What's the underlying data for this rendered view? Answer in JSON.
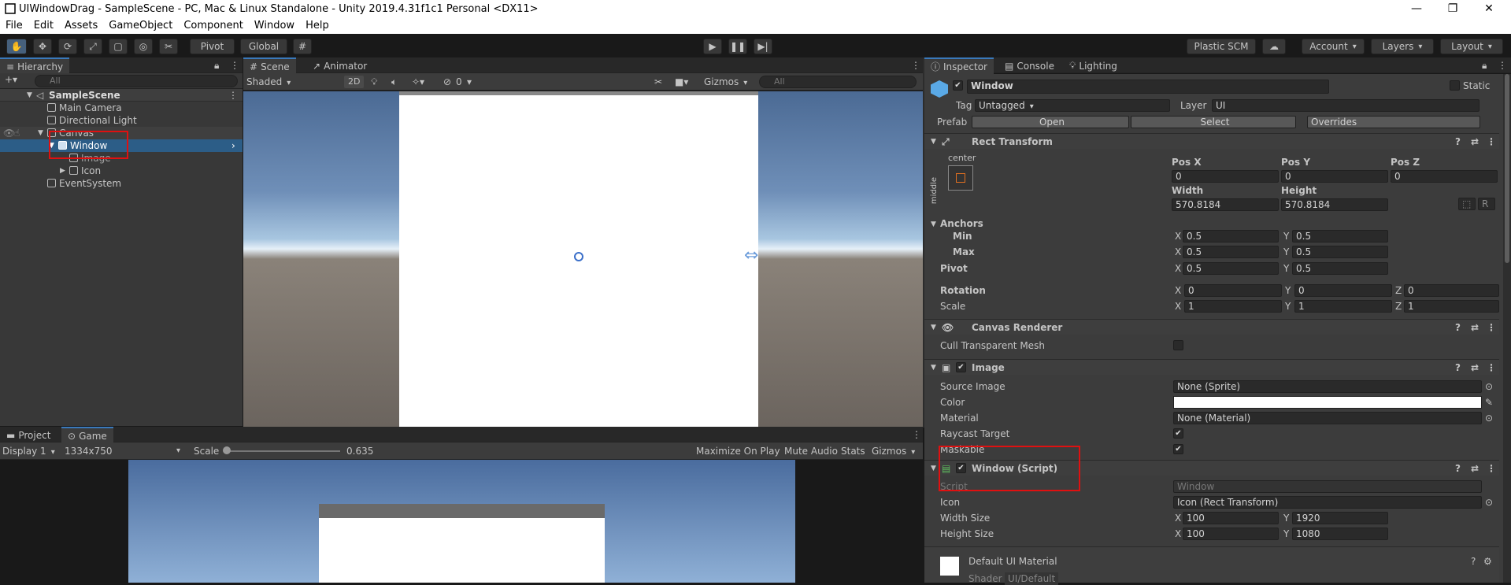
{
  "window": {
    "title": "UIWindowDrag - SampleScene - PC, Mac & Linux Standalone - Unity 2019.4.31f1c1 Personal <DX11>",
    "min": "—",
    "max": "❐",
    "close": "✕"
  },
  "menu": [
    "File",
    "Edit",
    "Assets",
    "GameObject",
    "Component",
    "Window",
    "Help"
  ],
  "toolbar": {
    "pivot": "Pivot",
    "global": "Global",
    "plastic": "Plastic SCM",
    "account": "Account",
    "layers": "Layers",
    "layout": "Layout"
  },
  "hierarchy": {
    "tab": "Hierarchy",
    "search_placeholder": "All",
    "scene": "SampleScene",
    "items": [
      "Main Camera",
      "Directional Light",
      "Canvas",
      "Window",
      "Image",
      "Icon",
      "EventSystem"
    ]
  },
  "scene_view": {
    "tab_scene": "Scene",
    "tab_animator": "Animator",
    "shading": "Shaded",
    "mode_2d": "2D",
    "fx_count": "0",
    "gizmos": "Gizmos",
    "search_placeholder": "All"
  },
  "game_view": {
    "tab_project": "Project",
    "tab_game": "Game",
    "display": "Display 1",
    "resolution": "1334x750",
    "scale_label": "Scale",
    "scale_value": "0.635",
    "maximize": "Maximize On Play",
    "mute": "Mute Audio",
    "stats": "Stats",
    "gizmos": "Gizmos"
  },
  "inspector": {
    "tabs": [
      "Inspector",
      "Console",
      "Lighting"
    ],
    "object_name": "Window",
    "static": "Static",
    "tag_label": "Tag",
    "tag": "Untagged",
    "layer_label": "Layer",
    "layer": "UI",
    "prefab_label": "Prefab",
    "open": "Open",
    "select": "Select",
    "overrides": "Overrides",
    "rect": {
      "title": "Rect Transform",
      "anchor_h": "center",
      "anchor_v": "middle",
      "posx_label": "Pos X",
      "posy_label": "Pos Y",
      "posz_label": "Pos Z",
      "posx": "0",
      "posy": "0",
      "posz": "0",
      "width_label": "Width",
      "height_label": "Height",
      "width": "570.8184",
      "height": "570.8184",
      "anchors": "Anchors",
      "min": "Min",
      "max": "Max",
      "min_x": "0.5",
      "min_y": "0.5",
      "max_x": "0.5",
      "max_y": "0.5",
      "pivot": "Pivot",
      "pivot_x": "0.5",
      "pivot_y": "0.5",
      "rotation": "Rotation",
      "rot_x": "0",
      "rot_y": "0",
      "rot_z": "0",
      "scale": "Scale",
      "scale_x": "1",
      "scale_y": "1",
      "scale_z": "1",
      "x": "X",
      "y": "Y",
      "z": "Z",
      "r": "R"
    },
    "canvas_renderer": {
      "title": "Canvas Renderer",
      "cull": "Cull Transparent Mesh"
    },
    "image": {
      "title": "Image",
      "source_label": "Source Image",
      "source": "None (Sprite)",
      "color_label": "Color",
      "material_label": "Material",
      "material": "None (Material)",
      "raycast_label": "Raycast Target",
      "maskable_label": "Maskable"
    },
    "script": {
      "title": "Window (Script)",
      "script_label": "Script",
      "script": "Window",
      "icon_label": "Icon",
      "icon": "Icon (Rect Transform)",
      "width_label": "Width Size",
      "width_x": "100",
      "width_y": "1920",
      "height_label": "Height Size",
      "height_x": "100",
      "height_y": "1080"
    },
    "material": {
      "title": "Default UI Material",
      "shader_label": "Shader",
      "shader": "UI/Default"
    }
  },
  "colors": {
    "accent": "#3a79bb",
    "selection": "#2c5d87",
    "highlight_box": "#e01010"
  }
}
